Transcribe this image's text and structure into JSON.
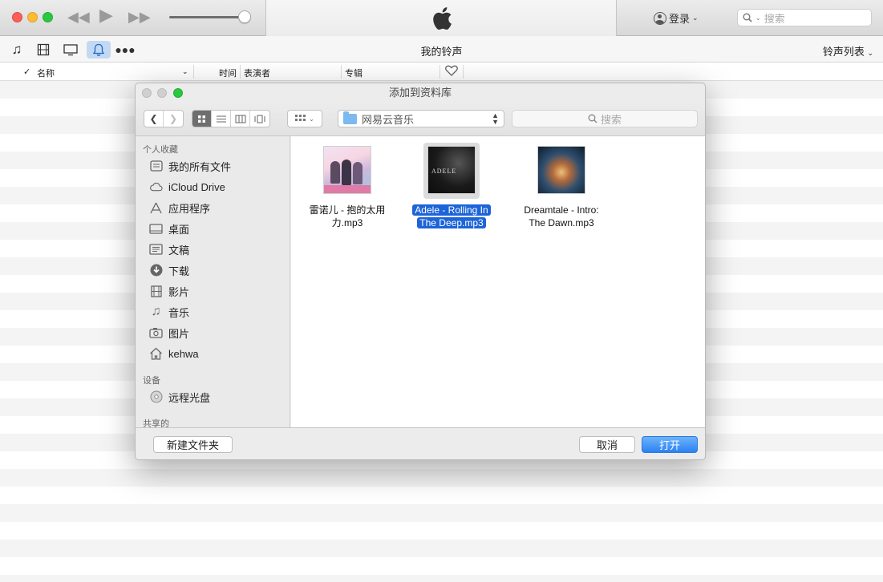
{
  "window": {
    "login_label": "登录",
    "search_placeholder": "搜索"
  },
  "toolbar": {
    "title": "我的铃声",
    "ringtone_list_label": "铃声列表",
    "media_icons": [
      "music-icon",
      "film-icon",
      "tv-icon",
      "bell-icon",
      "more-icon"
    ]
  },
  "columns": {
    "name": "名称",
    "time": "时间",
    "artist": "表演者",
    "album": "专辑"
  },
  "dialog": {
    "title": "添加到资料库",
    "location": "网易云音乐",
    "search_placeholder": "搜索",
    "sidebar": {
      "favorites_header": "个人收藏",
      "favorites": [
        {
          "label": "我的所有文件",
          "icon": "all-files-icon"
        },
        {
          "label": "iCloud Drive",
          "icon": "cloud-icon"
        },
        {
          "label": "应用程序",
          "icon": "applications-icon"
        },
        {
          "label": "桌面",
          "icon": "desktop-icon"
        },
        {
          "label": "文稿",
          "icon": "documents-icon"
        },
        {
          "label": "下载",
          "icon": "download-icon"
        },
        {
          "label": "影片",
          "icon": "movies-icon"
        },
        {
          "label": "音乐",
          "icon": "music-icon"
        },
        {
          "label": "图片",
          "icon": "pictures-icon"
        },
        {
          "label": "kehwa",
          "icon": "home-icon"
        }
      ],
      "devices_header": "设备",
      "devices": [
        {
          "label": "远程光盘",
          "icon": "disc-icon"
        }
      ],
      "shared_header": "共享的"
    },
    "files": [
      {
        "line1": "雷诺儿 - 抱的太用",
        "line2": "力.mp3",
        "selected": false
      },
      {
        "line1": "Adele - Rolling In",
        "line2": "The Deep.mp3",
        "selected": true
      },
      {
        "line1": "Dreamtale - Intro:",
        "line2": "The Dawn.mp3",
        "selected": false
      }
    ],
    "adele_cover_text": "ADELE",
    "new_folder_label": "新建文件夹",
    "cancel_label": "取消",
    "open_label": "打开"
  },
  "colors": {
    "selection_blue": "#1c64d8",
    "primary_button": "#2c82f4"
  }
}
